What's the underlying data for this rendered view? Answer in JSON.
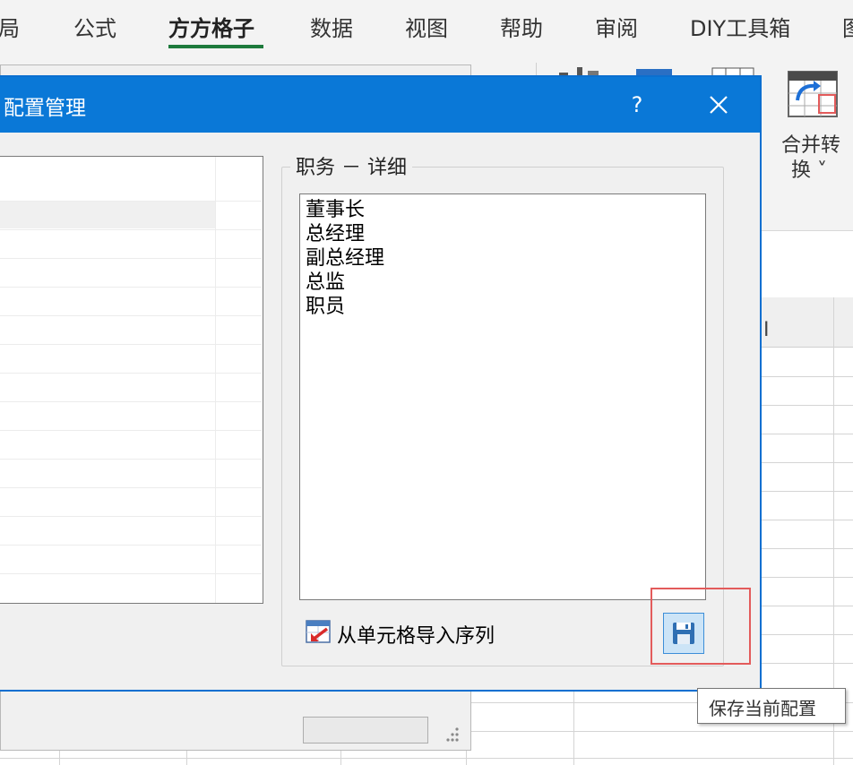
{
  "ribbon": {
    "tabs": [
      {
        "label": "局",
        "active": false
      },
      {
        "label": "公式",
        "active": false
      },
      {
        "label": "方方格子",
        "active": true
      },
      {
        "label": "数据",
        "active": false
      },
      {
        "label": "视图",
        "active": false
      },
      {
        "label": "帮助",
        "active": false
      },
      {
        "label": "审阅",
        "active": false
      },
      {
        "label": "DIY工具箱",
        "active": false
      },
      {
        "label": "图",
        "active": false
      }
    ],
    "merge_button": {
      "line1": "合并转",
      "line2": "换 ˅"
    },
    "accent_color": "#1e7a3c"
  },
  "sheet": {
    "column_letter": "I"
  },
  "dialog": {
    "title": "配置管理",
    "help_label": "?",
    "group_label": "职务 － 详细",
    "detail_items": [
      "董事长",
      "总经理",
      "副总经理",
      "总监",
      "职员"
    ],
    "import_label": "从单元格导入序列",
    "save_tooltip": "保存当前配置",
    "titlebar_color": "#0a78d7",
    "highlight_color": "#e35b5b"
  }
}
